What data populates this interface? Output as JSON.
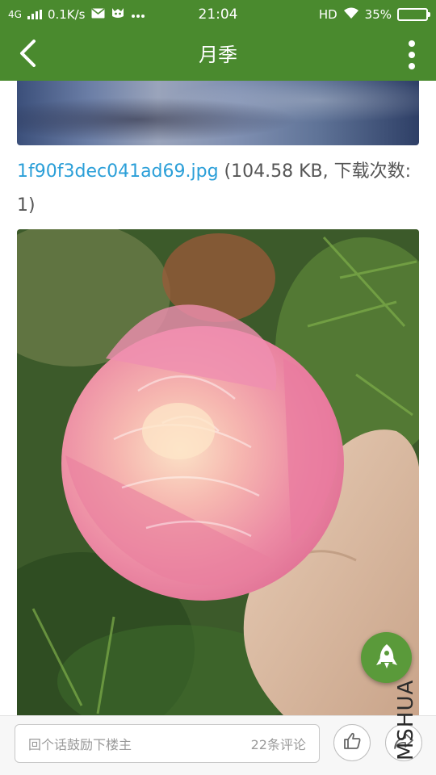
{
  "status_bar": {
    "network": "4G",
    "speed": "0.1K/s",
    "time": "21:04",
    "hd": "HD",
    "battery": "35%",
    "battery_level": 0.35
  },
  "nav": {
    "title": "月季"
  },
  "attachment": {
    "filename": "1f90f3dec041ad69.jpg",
    "meta": " (104.58 KB, 下载次数: 1)"
  },
  "comment_bar": {
    "placeholder": "回个话鼓励下楼主",
    "comment_count": "22条评论"
  },
  "watermark": "MSHUA",
  "colors": {
    "accent": "#4a8a2e",
    "link": "#2b9fd8",
    "fab": "#5a9a3a"
  }
}
